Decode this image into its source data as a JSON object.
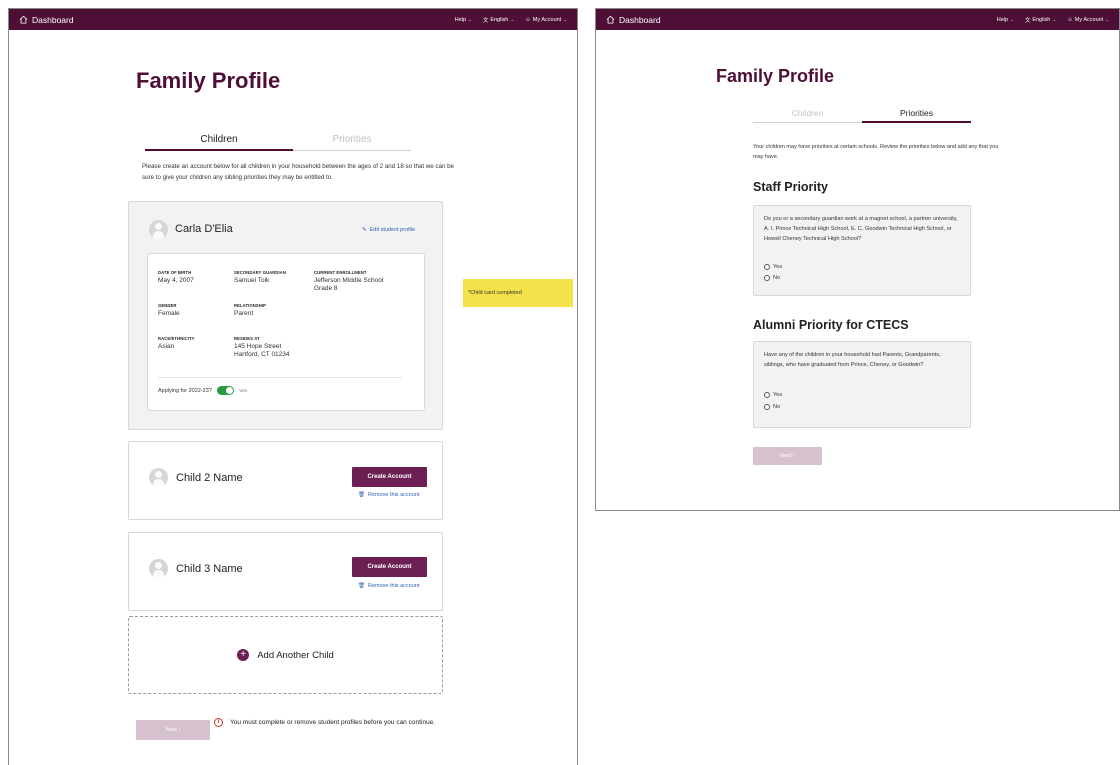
{
  "nav": {
    "home_label": "Dashboard",
    "help_label": "Help",
    "language_label": "English",
    "account_label": "My Account"
  },
  "page": {
    "title": "Family Profile"
  },
  "tabs": {
    "children": "Children",
    "priorities": "Priorities"
  },
  "children_screen": {
    "intro": "Please create an account below for all children in your household between the ages of 2 and 18 so that we can be sure to give your children any sibling priorities they may be entitled to.",
    "child1": {
      "name": "Carla D'Elia",
      "edit_label": "Edit student profile",
      "fields": {
        "dob_label": "DATE OF BIRTH",
        "dob": "May 4, 2007",
        "guardian_label": "SECONDARY GUARDIAN",
        "guardian": "Samuel Tolk",
        "enrollment_label": "CURRENT ENROLLMENT",
        "enrollment_school": "Jefferson Middle School",
        "enrollment_grade": "Grade 8",
        "gender_label": "GENDER",
        "gender": "Female",
        "relationship_label": "RELATIONSHIP",
        "relationship": "Parent",
        "race_label": "RACE/ETHNICITY",
        "race": "Asian",
        "resides_label": "RESIDES AT",
        "resides_street": "145 Hope Street",
        "resides_city": "Hartford, CT 01234"
      },
      "applying_label": "Applying for 2022-23?",
      "applying_value": "YES",
      "applying_on": true
    },
    "child2": {
      "name": "Child 2 Name",
      "create_label": "Create Account",
      "remove_label": "Remove this account"
    },
    "child3": {
      "name": "Child 3 Name",
      "create_label": "Create Account",
      "remove_label": "Remove this account"
    },
    "add_label": "Add Another Child",
    "next_label": "Next ›",
    "warning": "You must complete or remove student profiles before you can continue."
  },
  "annotation": {
    "note": "*Child card completed"
  },
  "priorities_screen": {
    "intro": "Your children may have priorities at certain schools. Review the priorities below and add any that you may have.",
    "staff": {
      "title": "Staff Priority",
      "question": "Do you or a secondary guardian work at a magnet school, a partner university, A. I. Prince Technical High School, E. C. Goodwin Technical High School, or Howell Cheney Technical High School?",
      "yes": "Yes",
      "no": "No"
    },
    "alumni": {
      "title": "Alumni Priority for CTECS",
      "question": "Have any of the children in your household had Parents, Grandparents, siblings, who have graduated from Prince, Cheney, or Goodwin?",
      "yes": "Yes",
      "no": "No"
    },
    "next_label": "Next ›"
  },
  "colors": {
    "brand": "#4e0f37",
    "button": "#6b1f52",
    "toggle_on": "#2b9a3e",
    "sticky": "#f4e24a",
    "link": "#2f5fb5"
  },
  "icons": {
    "home": "home-icon",
    "language": "translate-icon",
    "account": "user-icon",
    "edit": "pencil-icon",
    "remove": "trash-icon",
    "add": "plus-icon",
    "warning": "info-icon"
  }
}
